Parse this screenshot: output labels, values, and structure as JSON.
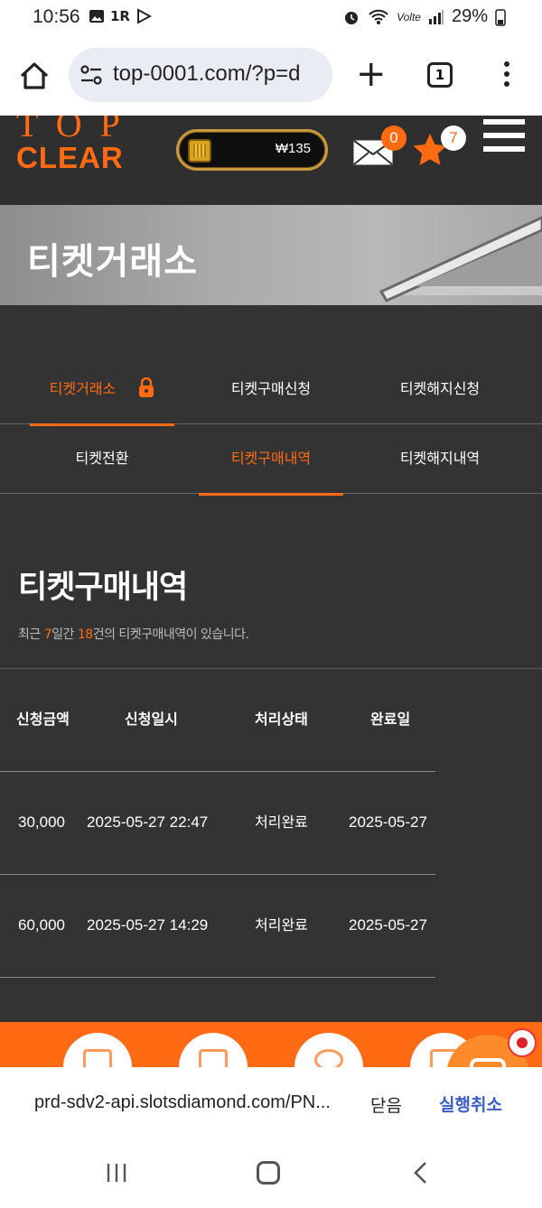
{
  "status": {
    "time": "10:56",
    "left_icons": [
      "image-icon",
      "1R",
      "play-icon"
    ],
    "battery": "29%",
    "network": "Volte"
  },
  "browser": {
    "url": "top-0001.com/?p=d",
    "tab_count": "1"
  },
  "site": {
    "logo_top": "TOP",
    "logo_main": "CLEAR",
    "wallet_amount": "₩135",
    "mail_count": "0",
    "star_count": "7",
    "brand_color": "#ff6a13"
  },
  "banner": {
    "title": "티켓거래소"
  },
  "tabs_row1": [
    {
      "label": "티켓거래소",
      "active": true
    },
    {
      "label": "티켓구매신청",
      "active": false
    },
    {
      "label": "티켓해지신청",
      "active": false
    }
  ],
  "tabs_row2": [
    {
      "label": "티켓전환",
      "active": false
    },
    {
      "label": "티켓구매내역",
      "active": true
    },
    {
      "label": "티켓해지내역",
      "active": false
    }
  ],
  "section": {
    "title": "티켓구매내역",
    "summary_prefix": "최근 ",
    "days": "7",
    "summary_mid": "일간 ",
    "count": "18",
    "summary_suffix": "건의 티켓구매내역이 있습니다."
  },
  "table": {
    "headers": [
      "신청금액",
      "신청일시",
      "처리상태",
      "완료일"
    ],
    "rows": [
      [
        "30,000",
        "2025-05-27 22:47",
        "처리완료",
        "2025-05-27"
      ],
      [
        "60,000",
        "2025-05-27 14:29",
        "처리완료",
        "2025-05-27"
      ]
    ]
  },
  "sheet": {
    "text": "prd-sdv2-api.slotsdiamond.com/PN...",
    "close_label": "닫음",
    "undo_label": "실행취소"
  }
}
